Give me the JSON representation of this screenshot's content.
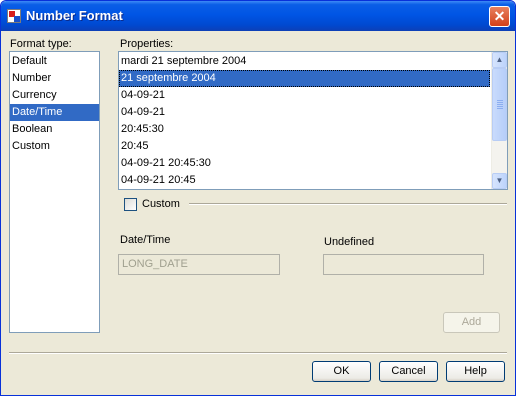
{
  "window": {
    "title": "Number Format",
    "close_symbol": "✕"
  },
  "format_type": {
    "label": "Format type:",
    "items": [
      "Default",
      "Number",
      "Currency",
      "Date/Time",
      "Boolean",
      "Custom"
    ],
    "selected": "Date/Time"
  },
  "properties": {
    "label": "Properties:",
    "items": [
      "mardi 21 septembre 2004",
      "21 septembre 2004",
      "04-09-21",
      "04-09-21",
      "20:45:30",
      "20:45",
      "04-09-21 20:45:30",
      "04-09-21 20:45"
    ],
    "selected": "21 septembre 2004"
  },
  "custom": {
    "label": "Custom",
    "checked": false
  },
  "date_time": {
    "label": "Date/Time",
    "value": "LONG_DATE"
  },
  "undefined_field": {
    "label": "Undefined",
    "value": ""
  },
  "buttons": {
    "add": "Add",
    "ok": "OK",
    "cancel": "Cancel",
    "help": "Help"
  },
  "icons": {
    "scroll_up": "▲",
    "scroll_down": "▼"
  }
}
